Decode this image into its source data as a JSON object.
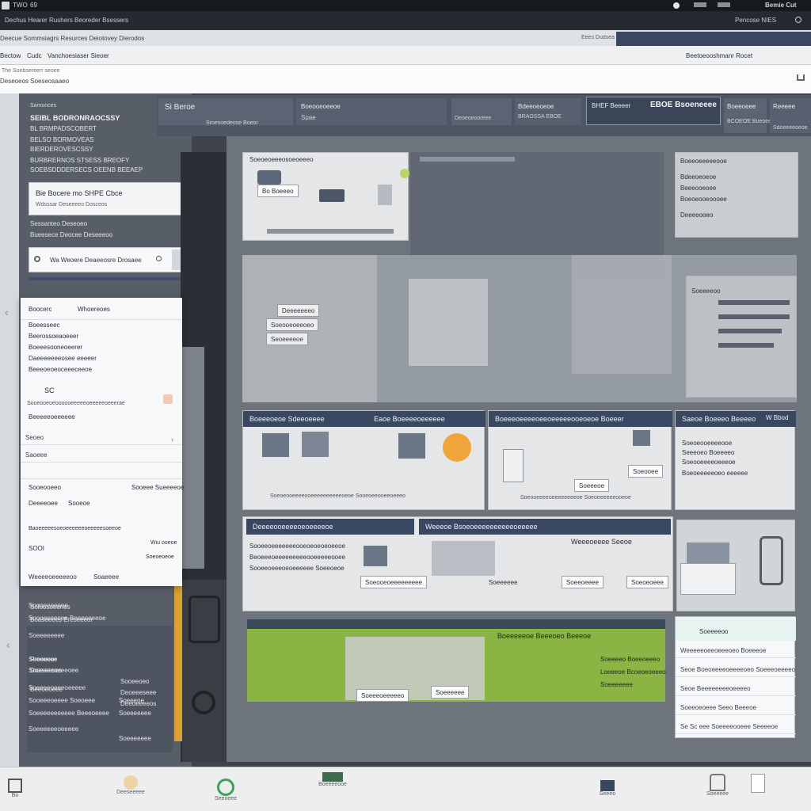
{
  "topbar": {
    "app_name": "TWO",
    "num": "69",
    "right_label": "Bemie Cut"
  },
  "addressbar": {
    "address": "Dechus Hearer Rushers Beoreder Bsessers",
    "right_label": "Pencose NIES"
  },
  "tabstrip": {
    "tab_left": "Deecue Sommsiagrs Resurces Deiotovey Dierodos",
    "tab_mid": "Eees Dudsea",
    "tab_right": ""
  },
  "menubar": {
    "items": [
      "Bectow",
      "Cudc",
      "Vanchoesiaser Sieoer"
    ],
    "right_label": "Beetoeooshmanr Rocet"
  },
  "crumb": {
    "line1": "The Soebsereerr seoee",
    "line2": "Deseoeos Soeseosaaeo"
  },
  "leftpanel": {
    "title": "Samonces",
    "heading": "SEIBL BODRONRAOCSSY",
    "lines": [
      "BL BRMPADSCOBERT",
      "BELSO BORMOVEAS",
      "BIERDEROVESCSSY",
      "BURBRERNOS STSESS BREOFY",
      "SOEBSDDDERSECS OEENB BEEAEP"
    ],
    "card1_title": "Bie Bocere mo SHPE Cbce",
    "card1_sub": "Wdsssar Deseeeeo Dosceos",
    "mid_lines": [
      "Sessanteo Deseoeo",
      "Bueesece Deocee Deseeeoo"
    ],
    "search_value": "Wa Weoere Deaeeosre Drosaee",
    "lower_lines": [
      "Soloosoeenes",
      "Boaseeees Ereseeeor",
      "Rreoeeer",
      "Doeseeses",
      "Beeoeoeee"
    ],
    "lower_right_lines": [
      "Sooeeoeo",
      "Deoeeeseee",
      "Deeoeeeeos"
    ]
  },
  "popup": {
    "head_left": "Boocerc",
    "head_right": "Whoereoes",
    "lines": [
      "Boeesseec",
      "Beerossoeaoeeer",
      "Boeeesooneoeerer",
      "Daeeeeeeeosee eeeeer",
      "Beeeoeoeoceeeceeoe"
    ],
    "tag": "SC",
    "long_line": "Sooeooeoeoooooeeeeeoeeeeeoeeerae",
    "item1": "Beeeeeoeeeeee",
    "item2": "Seoeo",
    "item3": "Saoeee",
    "section_left": "Sooeooeeo",
    "section_right": "Sooeee Sueeeeoe",
    "row_a_left": "Deeeeoee",
    "row_a_right": "Sooeoe",
    "long2": "Baoeeeeesoeoeeeeeeoeeeeesoeeoe",
    "foot_left": "SOOI",
    "foot_right": "Wiu ooeoe",
    "foot2": "Soeoeoeoe",
    "foot3_left": "Weeeeoeeeeeoo",
    "foot3_right": "Soaeeee"
  },
  "header": {
    "cells": [
      "Si Beroe",
      "Sroesoedeose Boeor",
      "Boeooeoeeoe",
      "Spae",
      "Deoeoeooreee",
      "Bdeeoeoeoe",
      "BRAOSSA EBOE",
      "BHEF Beeeer",
      "Boeeoeee",
      "BCOEOE Bueoeeeee",
      "Reeeee",
      "Sdoeeeeoeoe"
    ],
    "big_label": "EBOE Bsoeneeee"
  },
  "main": {
    "top_left_title": "Soeoeoeeeosoeoeeeo",
    "top_left_chip": "Bo Boeeeo",
    "top_right_title": "Boeeoeeeeeooe",
    "top_right_lines": [
      "Bdeeoeoeoe",
      "Beeeooeoee",
      "Boeoeooeoooee",
      "Deeeeooeo"
    ],
    "mid_chip1": "Deeeeeeeo",
    "mid_chip2": "Soeooeoeeoeo",
    "mid_chip3": "Seoeeeeoe",
    "right_mid_label": "Soeeeeoo",
    "sec1_title": "Boeeeoeoe Sdeeoeeee",
    "sec1_title_b": "Eaoe Boeeeeoeeeeee",
    "sec2_title": "Boeeeoeeeeoeeoeeeeeooeoeoe Boeeer",
    "sec3_title": "Saeoe Boeeeo Beeeeo",
    "sec3_badge": "W Bbod",
    "sec3_lines": [
      "Soeoeooeeeeooe",
      "Seeeoeo Boeeeeo",
      "Soeooeeeeoeeeoe",
      "Boeoeeeeeoeo eeeeee"
    ],
    "sec1_caption": "Soeoeooeeeeooeeeeeeeeeeoeoe Sooeoeeooeeoeeeo",
    "sec2_caption": "Soeooeeeeoeeeeeeeeoe Soeoeeeeeeooeoe",
    "sec2_chip": "Soeooee",
    "sec2_chip2": "Soeeeoe",
    "row2_title_a": "Deeeeooeeeeoeoeeeeoe",
    "row2_title_b": "Weeeoe Bsoeoeeeeeeeeeeoeeeee",
    "row2_lines": [
      "Sooeeoeeeeeeeooeoeoeoeoeeoe",
      "Beoeeeoeeeeeeeeeooeeeeeooee",
      "Sooeeoeeeoeoeeeeee Soeeoeoe"
    ],
    "row2_chip1": "Soeooeoeeeeeeeee",
    "row2_chip2": "Soeeoeeee",
    "row2_chip3": "Soeoeoeee",
    "row2_mid_label": "Weeeoeeee Seeoe",
    "row2_mid_sub": "Soeeeeee",
    "green_title": "Boeeeeeoe Beeeoeo Beeeoe",
    "green_lines": [
      "Soeeeeo Boeeoeeeo",
      "Loeeeoe Bcoeoeoeeeo",
      "Soeeeeeee"
    ],
    "green_chip1": "Soeeeoeeeeeo",
    "green_chip2": "Soeeeeee",
    "side_head": "Soeeeeoo",
    "side_rows": [
      "Weeeeeoeeoeeeoeo Boeeeoe",
      "Seoe Boeoeeeeoeeeeoeo Soeeeoeeeeo",
      "Seoe Beeeeeeeeoeeeeo",
      "Soeeoeoeee Seeo Beeeoe",
      "Se Sc eee Soeeeeooeee Seeeeoe"
    ]
  },
  "leftbottom": {
    "lines": [
      "Soooeeeeeee",
      "Soooeeeeeee Beeeeeeeoe",
      "Soeeeeeeee",
      "Seeeeeoe",
      "Sooeeeeoeeeoee",
      "Soeeeeoeeeoeeeee"
    ],
    "pairs": [
      [
        "Sooeeeoeeee Soeoeee",
        "Soeeeoe"
      ],
      [
        "Soeeeeeeeeeee Beeeoeeee",
        "Soeeeeeee"
      ],
      [
        "Soeeeeeeoeeeee",
        "Soeeeeeee"
      ]
    ]
  },
  "dock": {
    "items": [
      "Bo",
      "Deeseeeee",
      "Seeoeee",
      "Boeeeeooe",
      "Seeeo",
      "Soeeeee"
    ]
  }
}
